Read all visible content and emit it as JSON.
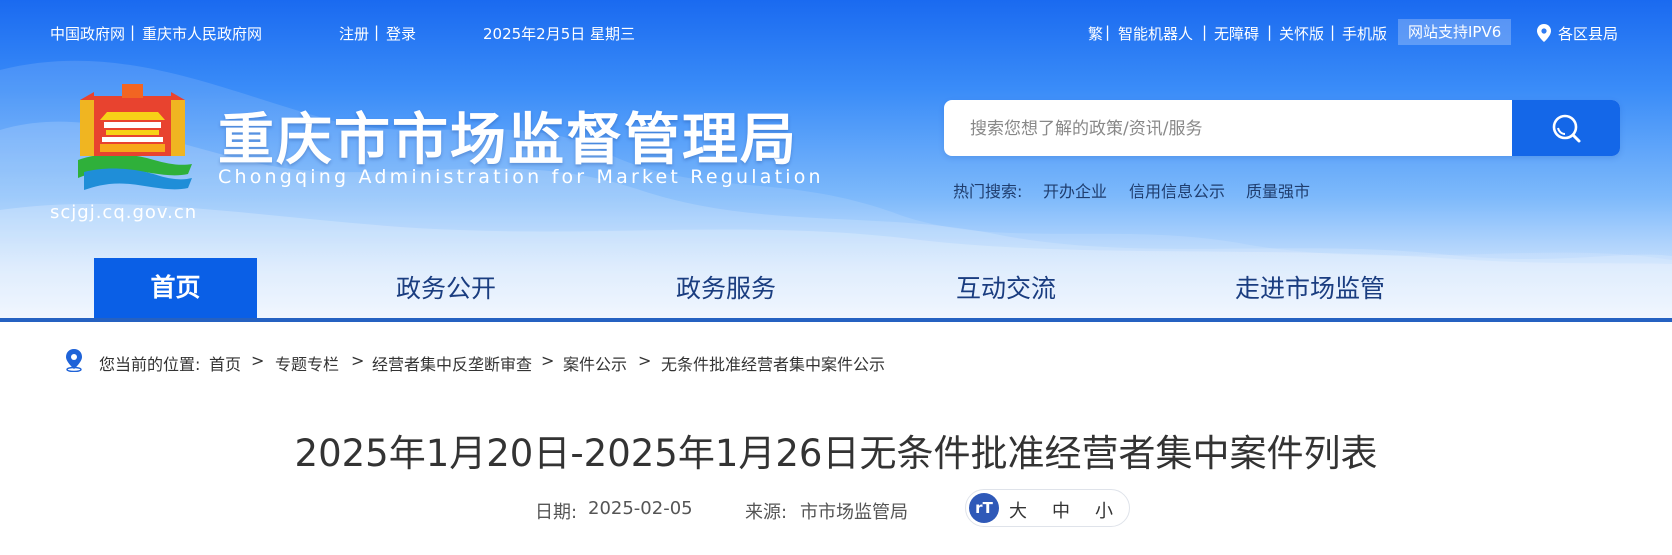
{
  "topbar": {
    "links_left": [
      "中国政府网",
      "重庆市人民政府网"
    ],
    "auth": [
      "注册",
      "登录"
    ],
    "date": "2025年2月5日 星期三",
    "links_right": [
      "繁",
      "智能机器人",
      "无障碍",
      "关怀版",
      "手机版"
    ],
    "ipv6": "网站支持IPV6",
    "district": "各区县局"
  },
  "header": {
    "site_name": "重庆市市场监督管理局",
    "site_name_en": "Chongqing Administration for Market Regulation",
    "domain": "scjgj.cq.gov.cn"
  },
  "search": {
    "placeholder": "搜索您想了解的政策/资讯/服务",
    "hot_label": "热门搜索:",
    "hot_terms": [
      "开办企业",
      "信用信息公示",
      "质量强市"
    ]
  },
  "nav": {
    "items": [
      "首页",
      "政务公开",
      "政务服务",
      "互动交流",
      "走进市场监管"
    ],
    "active_index": 0
  },
  "breadcrumb": {
    "label": "您当前的位置:",
    "items": [
      "首页",
      "专题专栏",
      "经营者集中反垄断审查",
      "案件公示",
      "无条件批准经营者集中案件公示"
    ],
    "separator": ">"
  },
  "article": {
    "title": "2025年1月20日-2025年1月26日无条件批准经营者集中案件列表",
    "date_label": "日期:",
    "date": "2025-02-05",
    "source_label": "来源:",
    "source": "市市场监管局",
    "font_sizes": [
      "大",
      "中",
      "小"
    ]
  },
  "colors": {
    "nav_active": "#0a5fe6",
    "nav_active_underline": "#e0191d",
    "search_button": "#1467e8",
    "nav_text": "#1a3d80"
  },
  "icons": [
    "location-pin-icon",
    "search-icon",
    "breadcrumb-location-icon",
    "font-size-icon"
  ]
}
